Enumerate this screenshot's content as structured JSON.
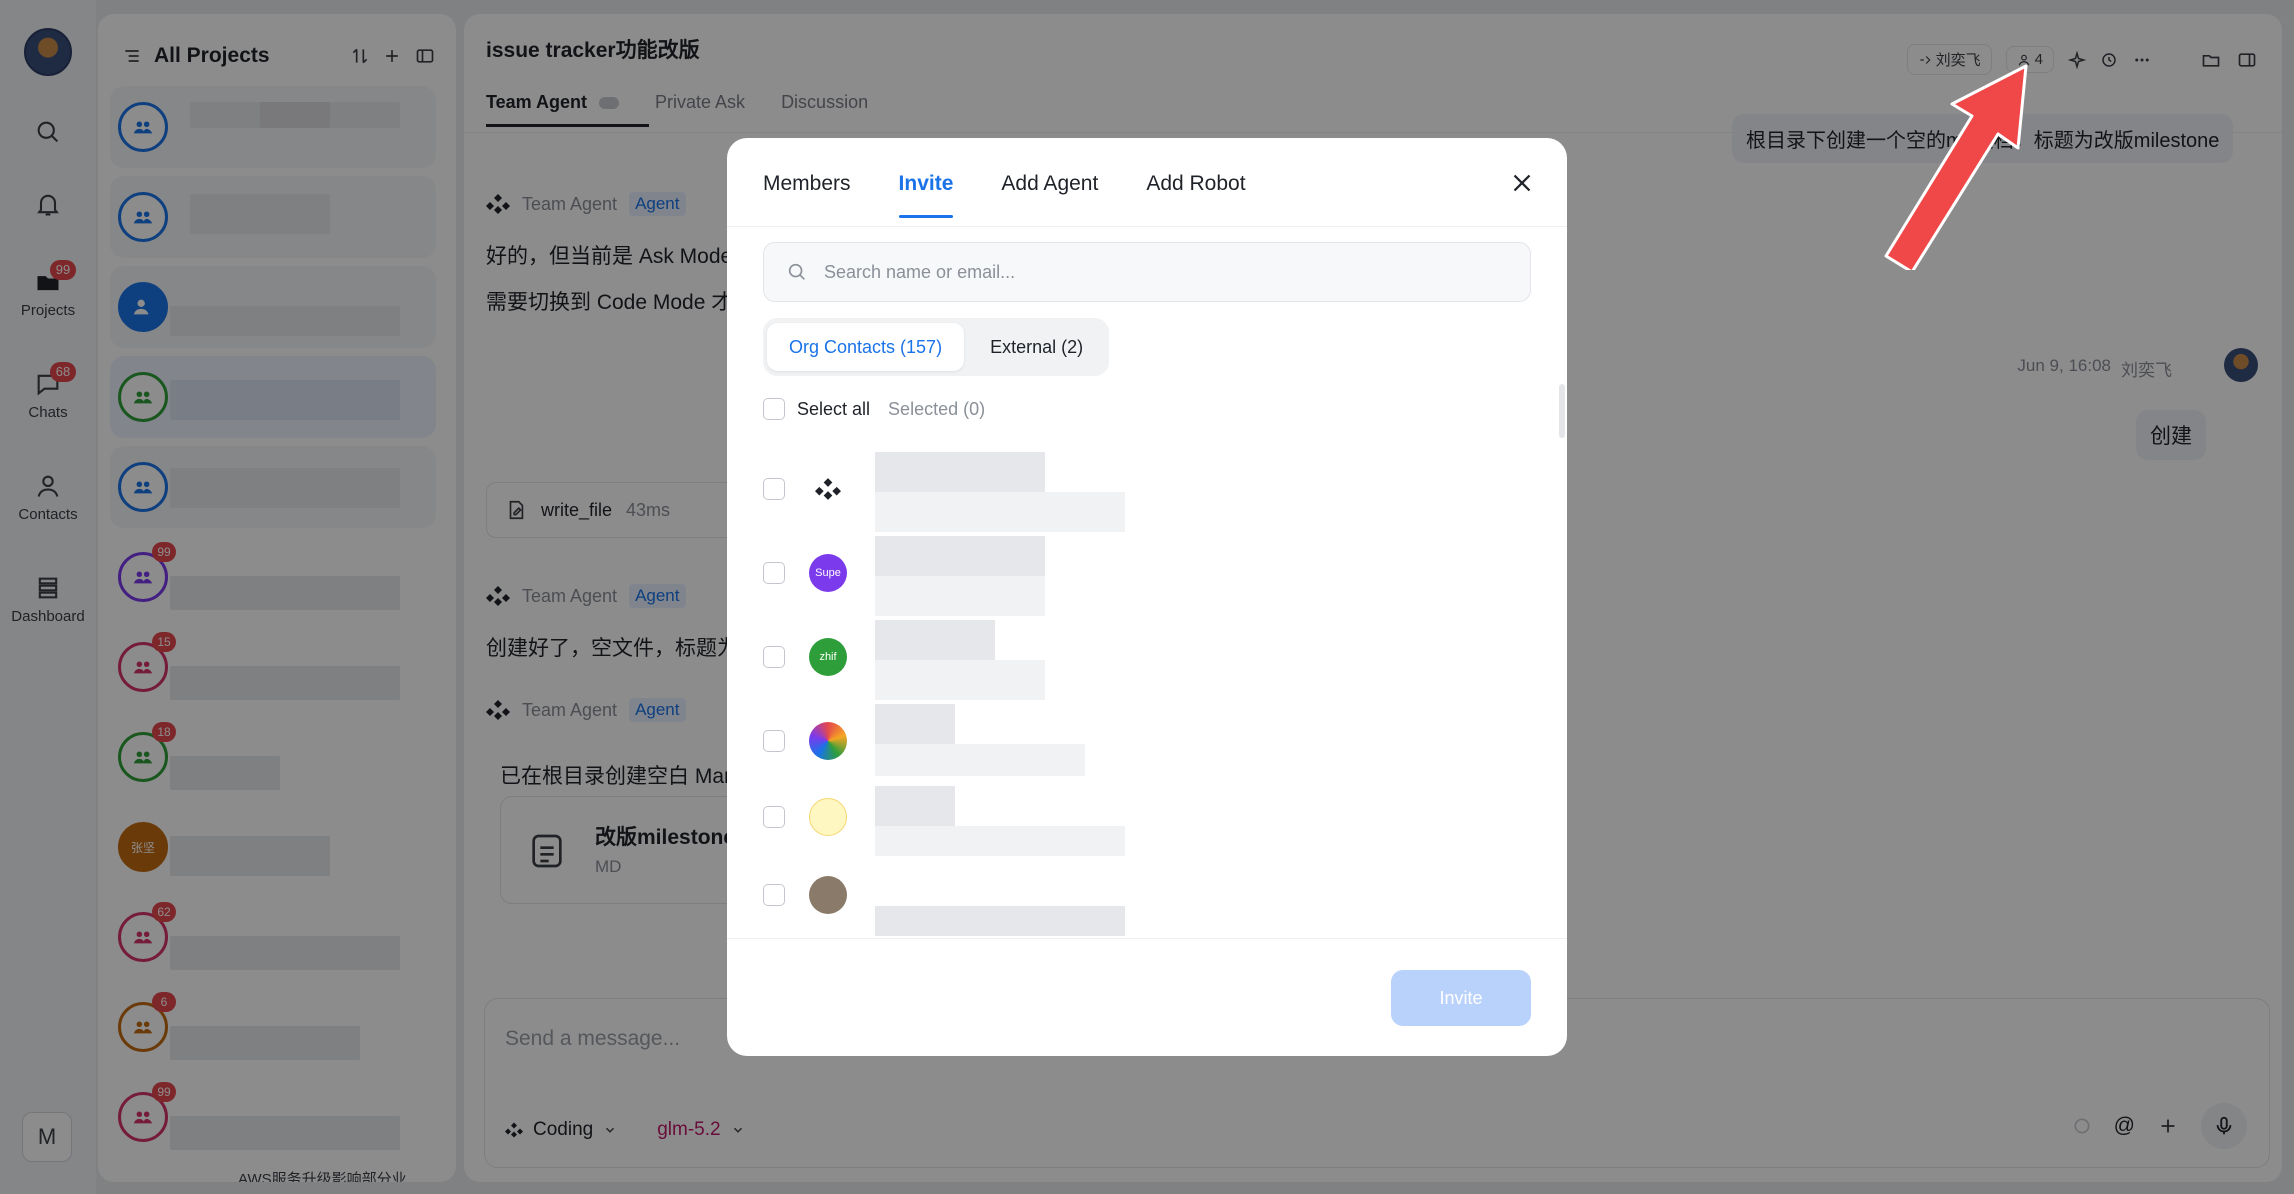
{
  "rail": {
    "items": [
      {
        "label": "",
        "icon": "search-icon"
      },
      {
        "label": "",
        "icon": "bell-icon"
      },
      {
        "label": "Projects",
        "icon": "folder-icon",
        "badge": "99"
      },
      {
        "label": "Chats",
        "icon": "chat-icon",
        "badge": "68"
      },
      {
        "label": "Contacts",
        "icon": "person-icon"
      },
      {
        "label": "Dashboard",
        "icon": "stack-icon"
      }
    ],
    "user_initial": "M"
  },
  "projects": {
    "title": "All Projects",
    "badges": [
      "99",
      "15",
      "18",
      "62",
      "6",
      "99"
    ],
    "named_avatar": "张坚",
    "bottom_text": "AWS服务升级影响部分业"
  },
  "chat": {
    "title": "issue tracker功能改版",
    "tabs": [
      "Team Agent",
      "Private Ask",
      "Discussion"
    ],
    "header_user": "刘奕飞",
    "member_count": "4",
    "messages": [
      {
        "sender": "Team Agent",
        "tag": "Agent",
        "lines": [
          "好的，但当前是 Ask Mode",
          "需要切换到 Code Mode 才"
        ]
      },
      {
        "sender": "Team Agent",
        "tag": "Agent",
        "lines": [
          "创建好了，空文件，标题为"
        ]
      },
      {
        "sender": "Team Agent",
        "tag": "Agent",
        "lines": [
          "已在根目录创建空白 Mar"
        ]
      }
    ],
    "tool": {
      "name": "write_file",
      "time": "43ms"
    },
    "file": {
      "name": "改版milestone",
      "type": "MD"
    },
    "user_bubble_top": "根目录下创建一个空的md文档，标题为改版milestone",
    "user_time": "Jun 9, 16:08",
    "user_name": "刘奕飞",
    "user_bubble": "创建",
    "composer": {
      "placeholder": "Send a message...",
      "mode": "Coding",
      "model": "glm-5.2"
    }
  },
  "modal": {
    "tabs": [
      "Members",
      "Invite",
      "Add Agent",
      "Add Robot"
    ],
    "active_tab": "Invite",
    "search_placeholder": "Search name or email...",
    "segments": [
      "Org Contacts (157)",
      "External (2)"
    ],
    "select_all": "Select all",
    "selected": "Selected (0)",
    "contacts": [
      {
        "avatar_text": "",
        "color": "#ffffff"
      },
      {
        "avatar_text": "Supe",
        "color": "#7c3aed"
      },
      {
        "avatar_text": "zhif",
        "color": "#2e9e3a"
      },
      {
        "avatar_text": "",
        "color": "#ffffff"
      },
      {
        "avatar_text": "",
        "color": "#fff7c2"
      },
      {
        "avatar_text": "",
        "color": "#8a7a6a"
      }
    ],
    "invite_label": "Invite"
  },
  "colors": {
    "accent": "#1a73e8",
    "badge": "#e5484d",
    "annotation_arrow": "#f04848"
  }
}
